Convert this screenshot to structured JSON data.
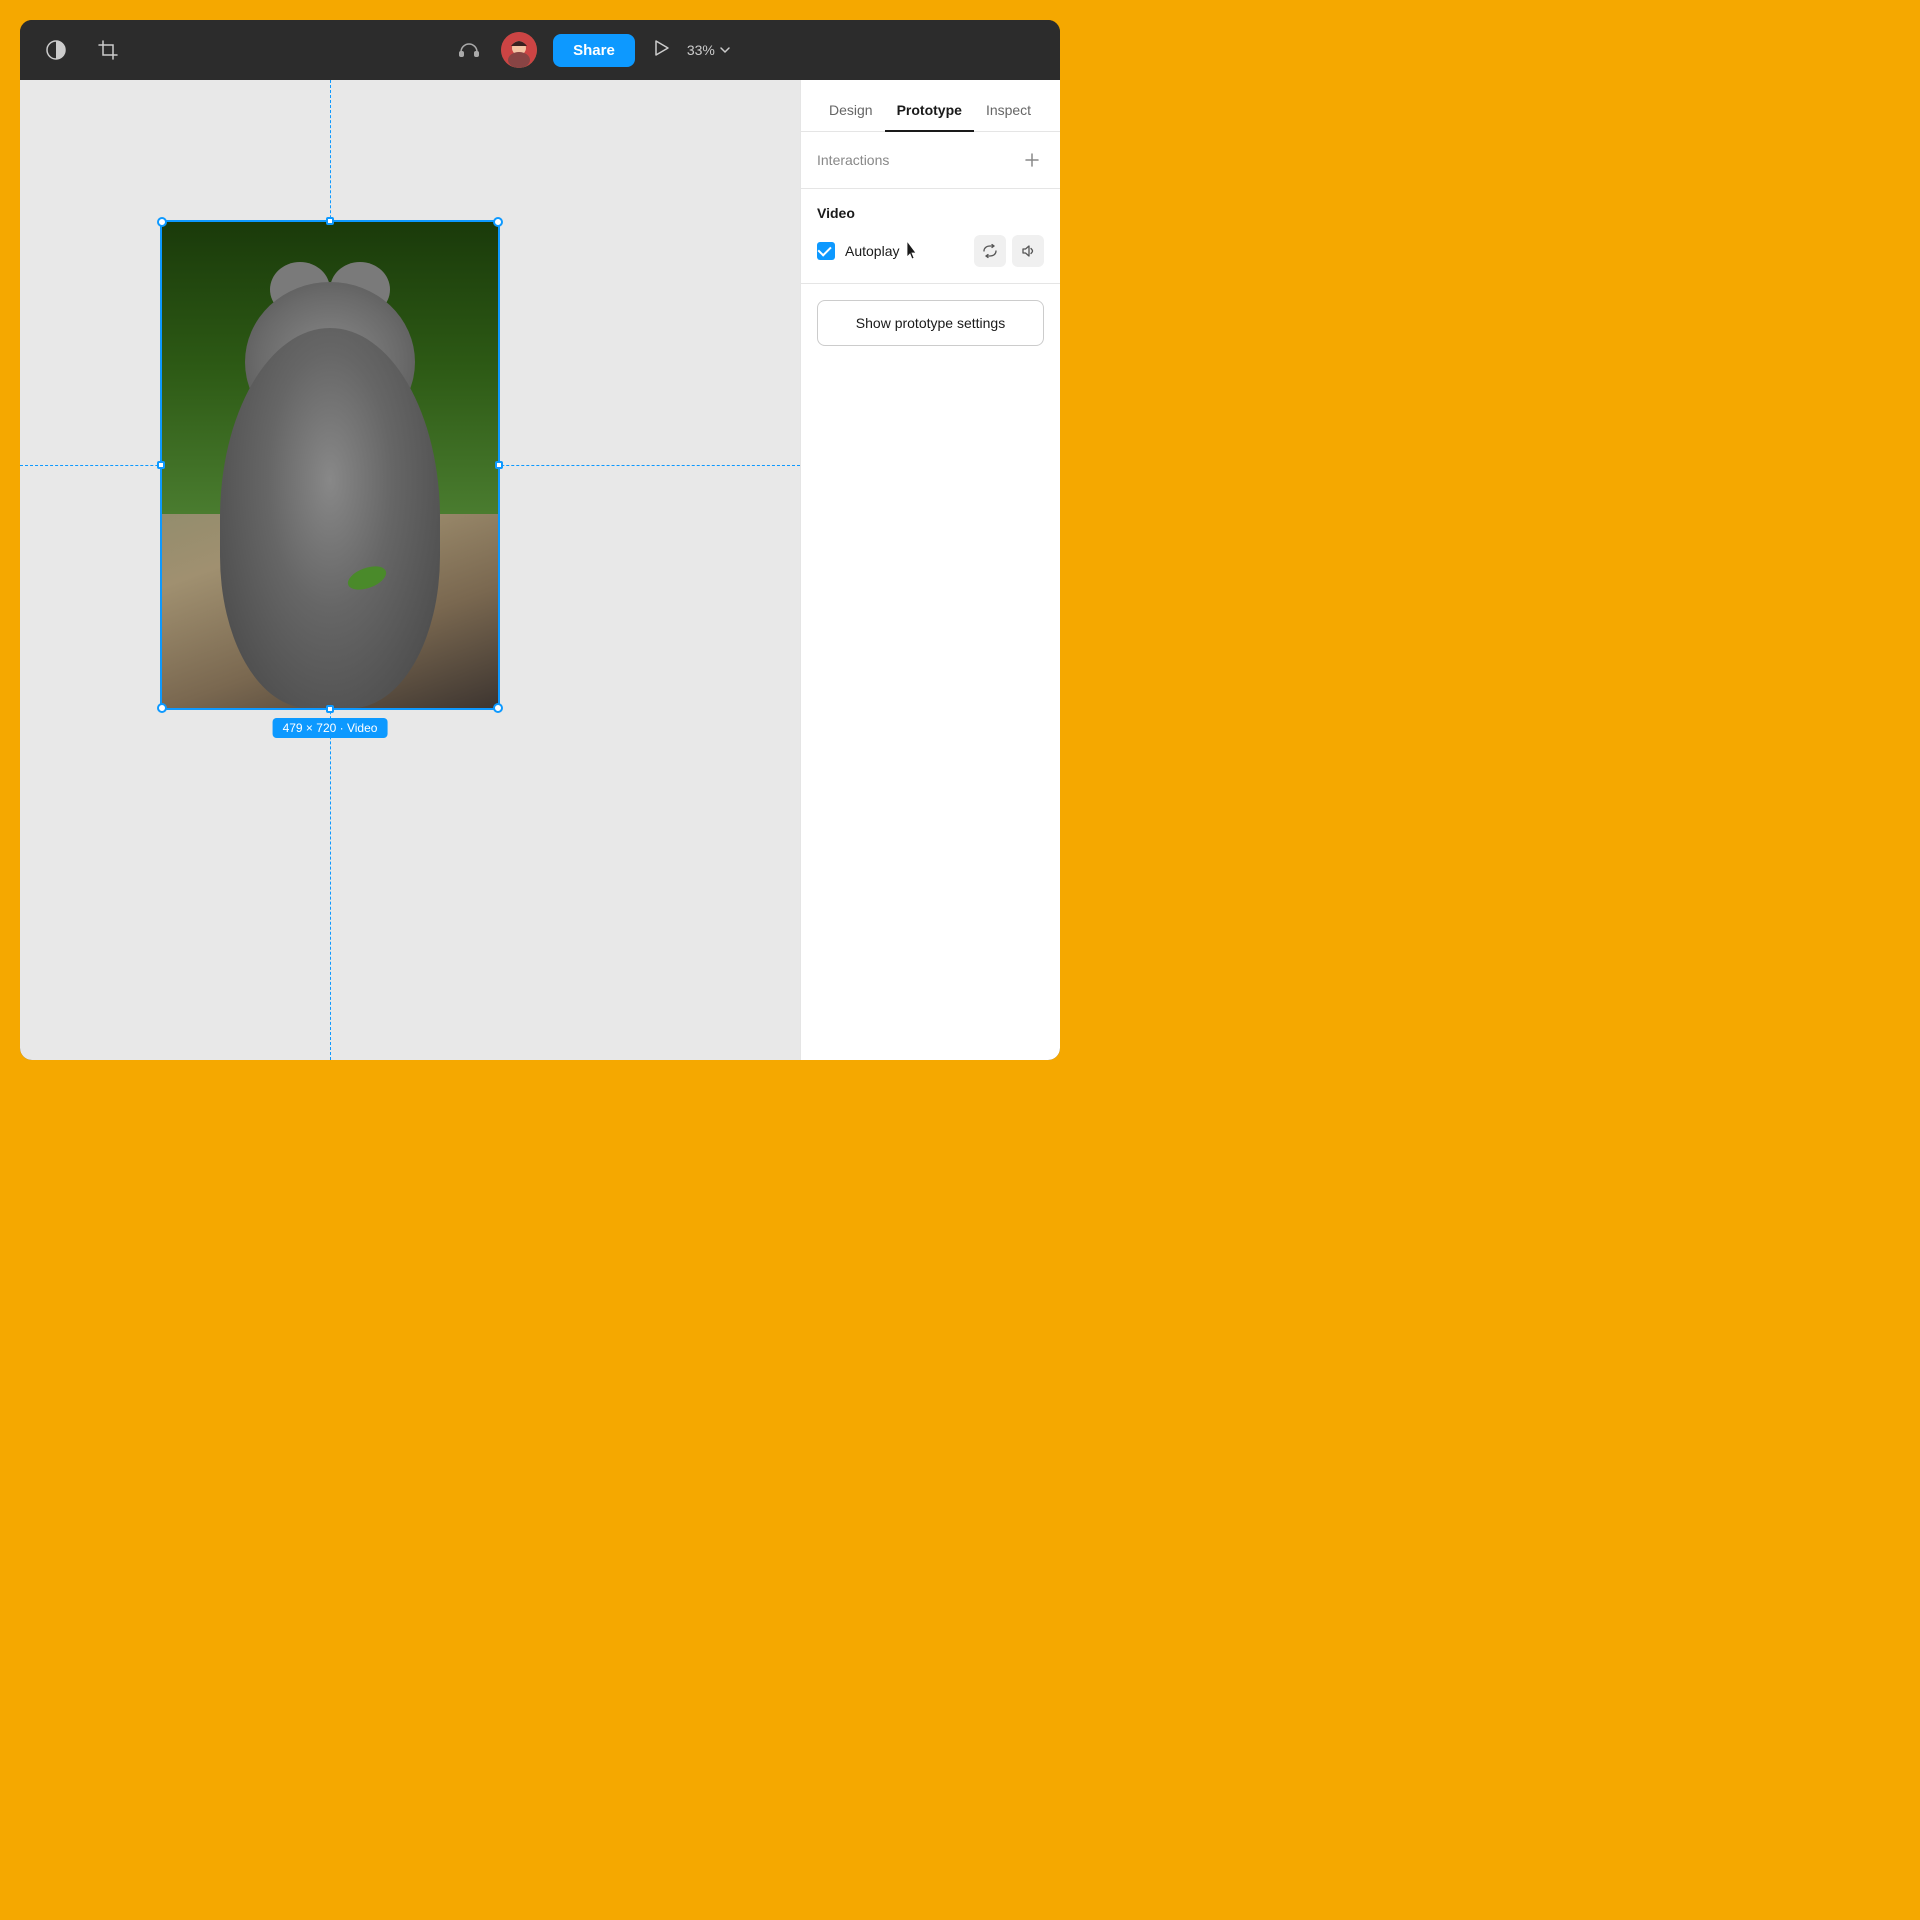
{
  "window": {
    "background_color": "#F5A800"
  },
  "titlebar": {
    "contrast_icon_label": "contrast",
    "crop_icon_label": "crop",
    "headphone_icon_label": "headphones",
    "share_button_label": "Share",
    "play_icon_label": "play",
    "zoom_level": "33%",
    "zoom_dropdown_label": "zoom-dropdown"
  },
  "panel": {
    "tabs": [
      {
        "id": "design",
        "label": "Design",
        "active": false
      },
      {
        "id": "prototype",
        "label": "Prototype",
        "active": true
      },
      {
        "id": "inspect",
        "label": "Inspect",
        "active": false
      }
    ],
    "interactions_section": {
      "title": "Interactions",
      "add_icon_label": "add"
    },
    "video_section": {
      "title": "Video",
      "autoplay_label": "Autoplay",
      "autoplay_checked": true,
      "loop_icon_label": "loop",
      "mute_icon_label": "mute"
    },
    "prototype_settings": {
      "button_label": "Show prototype settings"
    }
  },
  "canvas": {
    "element_label": "479 × 720 · Video",
    "element_width": 479,
    "element_height": 720,
    "element_type": "Video"
  }
}
